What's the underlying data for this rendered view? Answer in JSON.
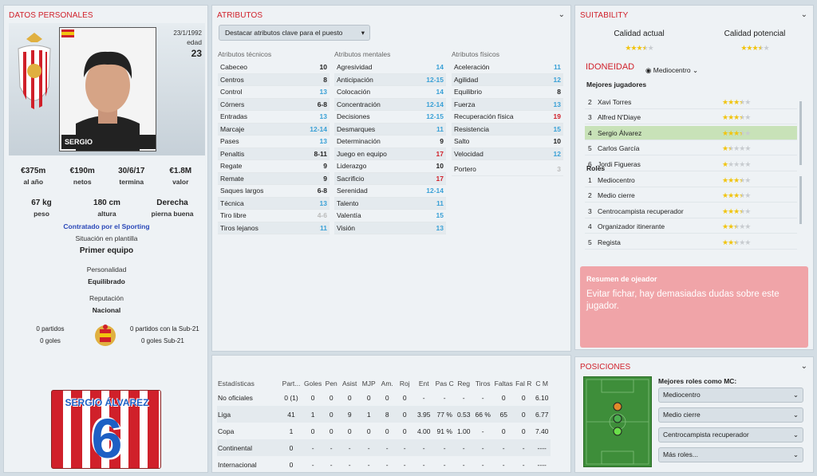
{
  "personal": {
    "title": "DATOS PERSONALES",
    "birth": "23/1/1992",
    "age_label": "edad",
    "age": "23",
    "photo_caption": "SERGIO",
    "wage": "€375m",
    "wage_label": "al año",
    "net": "€190m",
    "net_label": "netos",
    "ends": "30/6/17",
    "ends_label": "termina",
    "value": "€1.8M",
    "value_label": "valor",
    "weight": "67 kg",
    "weight_label": "peso",
    "height": "180 cm",
    "height_label": "altura",
    "foot": "Derecha",
    "foot_label": "pierna buena",
    "contract": "Contratado por el Sporting",
    "squad_status_label": "Situación en plantilla",
    "squad_status": "Primer equipo",
    "personality_label": "Personalidad",
    "personality": "Equilibrado",
    "reputation_label": "Reputación",
    "reputation": "Nacional",
    "matches": "0 partidos",
    "goals": "0 goles",
    "u21_matches": "0 partidos con la Sub-21",
    "u21_goals": "0 goles Sub-21",
    "shirt_name": "SERGIO ÁLVAREZ",
    "shirt_number": "6"
  },
  "attributes": {
    "title": "ATRIBUTOS",
    "highlight_button": "Destacar atributos clave para el puesto",
    "technical_header": "Atributos técnicos",
    "mental_header": "Atributos mentales",
    "physical_header": "Atributos físicos",
    "technical": [
      {
        "name": "Cabeceo",
        "value": "10",
        "c": ""
      },
      {
        "name": "Centros",
        "value": "8",
        "c": ""
      },
      {
        "name": "Control",
        "value": "13",
        "c": "blue"
      },
      {
        "name": "Córners",
        "value": "6-8",
        "c": ""
      },
      {
        "name": "Entradas",
        "value": "13",
        "c": "blue"
      },
      {
        "name": "Marcaje",
        "value": "12-14",
        "c": "blue"
      },
      {
        "name": "Pases",
        "value": "13",
        "c": "blue"
      },
      {
        "name": "Penaltis",
        "value": "8-11",
        "c": ""
      },
      {
        "name": "Regate",
        "value": "9",
        "c": ""
      },
      {
        "name": "Remate",
        "value": "9",
        "c": ""
      },
      {
        "name": "Saques largos",
        "value": "6-8",
        "c": ""
      },
      {
        "name": "Técnica",
        "value": "13",
        "c": "blue"
      },
      {
        "name": "Tiro libre",
        "value": "4-6",
        "c": "grey"
      },
      {
        "name": "Tiros lejanos",
        "value": "11",
        "c": "blue"
      }
    ],
    "mental": [
      {
        "name": "Agresividad",
        "value": "14",
        "c": "blue"
      },
      {
        "name": "Anticipación",
        "value": "12-15",
        "c": "blue"
      },
      {
        "name": "Colocación",
        "value": "14",
        "c": "blue"
      },
      {
        "name": "Concentración",
        "value": "12-14",
        "c": "blue"
      },
      {
        "name": "Decisiones",
        "value": "12-15",
        "c": "blue"
      },
      {
        "name": "Desmarques",
        "value": "11",
        "c": "blue"
      },
      {
        "name": "Determinación",
        "value": "9",
        "c": ""
      },
      {
        "name": "Juego en equipo",
        "value": "17",
        "c": "red"
      },
      {
        "name": "Liderazgo",
        "value": "10",
        "c": ""
      },
      {
        "name": "Sacrificio",
        "value": "17",
        "c": "red"
      },
      {
        "name": "Serenidad",
        "value": "12-14",
        "c": "blue"
      },
      {
        "name": "Talento",
        "value": "11",
        "c": "blue"
      },
      {
        "name": "Valentía",
        "value": "15",
        "c": "blue"
      },
      {
        "name": "Visión",
        "value": "13",
        "c": "blue"
      }
    ],
    "physical": [
      {
        "name": "Aceleración",
        "value": "11",
        "c": "blue"
      },
      {
        "name": "Agilidad",
        "value": "12",
        "c": "blue"
      },
      {
        "name": "Equilibrio",
        "value": "8",
        "c": ""
      },
      {
        "name": "Fuerza",
        "value": "13",
        "c": "blue"
      },
      {
        "name": "Recuperación física",
        "value": "19",
        "c": "red"
      },
      {
        "name": "Resistencia",
        "value": "15",
        "c": "blue"
      },
      {
        "name": "Salto",
        "value": "10",
        "c": ""
      },
      {
        "name": "Velocidad",
        "value": "12",
        "c": "blue"
      }
    ],
    "goalkeeper": {
      "name": "Portero",
      "value": "3",
      "c": "grey"
    }
  },
  "suitability": {
    "title": "SUITABILITY",
    "current_label": "Calidad actual",
    "potential_label": "Calidad potencial",
    "current_stars": 3.5,
    "potential_stars": 3.5,
    "idoneidad_label": "IDONEIDAD",
    "position_select": "Mediocentro",
    "best_players_label": "Mejores jugadores",
    "players": [
      {
        "rank": "2",
        "name": "Xavi Torres",
        "stars": 3.5
      },
      {
        "rank": "3",
        "name": "Alfred N'Diaye",
        "stars": 3.5
      },
      {
        "rank": "4",
        "name": "Sergio Álvarez",
        "stars": 3.5
      },
      {
        "rank": "5",
        "name": "Carlos García",
        "stars": 1.5
      },
      {
        "rank": "6",
        "name": "Jordi Figueras",
        "stars": 1
      }
    ],
    "roles_label": "Roles",
    "roles": [
      {
        "rank": "1",
        "name": "Mediocentro",
        "stars": 3.5
      },
      {
        "rank": "2",
        "name": "Medio cierre",
        "stars": 3.5
      },
      {
        "rank": "3",
        "name": "Centrocampista recuperador",
        "stars": 3.5
      },
      {
        "rank": "4",
        "name": "Organizador itinerante",
        "stars": 2.5
      },
      {
        "rank": "5",
        "name": "Regista",
        "stars": 2.5
      }
    ],
    "scout_title": "Resumen de ojeador",
    "scout_text": "Evitar fichar, hay demasiadas dudas sobre este jugador."
  },
  "stats": {
    "headers": [
      "Estadísticas",
      "Part...",
      "Goles",
      "Pen",
      "Asist",
      "MJP",
      "Am.",
      "Roj",
      "Ent",
      "Pas C",
      "Reg",
      "Tiros",
      "Faltas",
      "Fal R",
      "C M"
    ],
    "rows": [
      [
        "No oficiales",
        "0 (1)",
        "0",
        "0",
        "0",
        "0",
        "0",
        "0",
        "-",
        "-",
        "-",
        "-",
        "0",
        "0",
        "6.10"
      ],
      [
        "Liga",
        "41",
        "1",
        "0",
        "9",
        "1",
        "8",
        "0",
        "3.95",
        "77 %",
        "0.53",
        "66 %",
        "65",
        "0",
        "6.77"
      ],
      [
        "Copa",
        "1",
        "0",
        "0",
        "0",
        "0",
        "0",
        "0",
        "4.00",
        "91 %",
        "1.00",
        "-",
        "0",
        "0",
        "7.40"
      ],
      [
        "Continental",
        "0",
        "-",
        "-",
        "-",
        "-",
        "-",
        "-",
        "-",
        "-",
        "-",
        "-",
        "-",
        "-",
        "----"
      ],
      [
        "Internacional",
        "0",
        "-",
        "-",
        "-",
        "-",
        "-",
        "-",
        "-",
        "-",
        "-",
        "-",
        "-",
        "-",
        "----"
      ]
    ]
  },
  "positions": {
    "title": "POSICIONES",
    "best_roles_label": "Mejores roles como MC:",
    "roles": [
      "Mediocentro",
      "Medio cierre",
      "Centrocampista recuperador",
      "Más roles..."
    ]
  },
  "colors": {
    "accent": "#d0202a",
    "highlight": "#39a0d6",
    "selected": "#c8e2b8",
    "scout_bg": "#f0a4a8"
  }
}
